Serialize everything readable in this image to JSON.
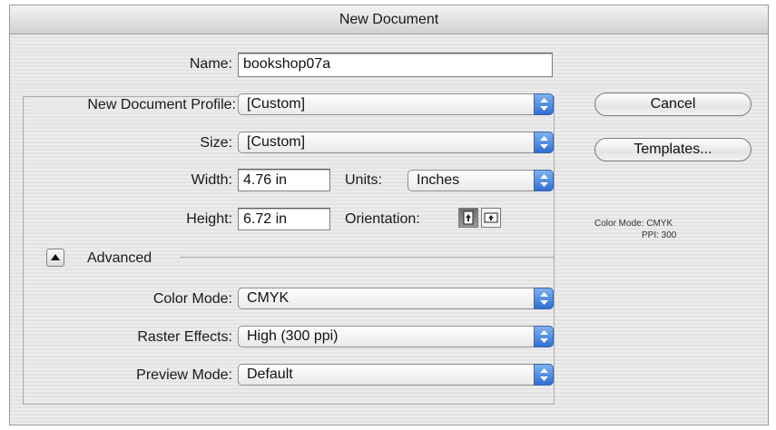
{
  "window": {
    "title": "New Document"
  },
  "name": {
    "label": "Name:",
    "value": "bookshop07a"
  },
  "profile": {
    "label": "New Document Profile:",
    "value": "[Custom]"
  },
  "size": {
    "label": "Size:",
    "value": "[Custom]"
  },
  "width": {
    "label": "Width:",
    "value": "4.76 in"
  },
  "units": {
    "label": "Units:",
    "value": "Inches"
  },
  "height": {
    "label": "Height:",
    "value": "6.72 in"
  },
  "orientation": {
    "label": "Orientation:",
    "selected": "portrait"
  },
  "advanced": {
    "label": "Advanced"
  },
  "color_mode": {
    "label": "Color Mode:",
    "value": "CMYK"
  },
  "raster_effects": {
    "label": "Raster Effects:",
    "value": "High (300 ppi)"
  },
  "preview_mode": {
    "label": "Preview Mode:",
    "value": "Default"
  },
  "buttons": {
    "cancel": "Cancel",
    "templates": "Templates..."
  },
  "info": {
    "color_mode_line": "Color Mode: CMYK",
    "ppi_line": "PPI: 300"
  },
  "colors": {
    "popup_arrow": "#2f6fd2",
    "window_bg": "#e8e8e8"
  }
}
